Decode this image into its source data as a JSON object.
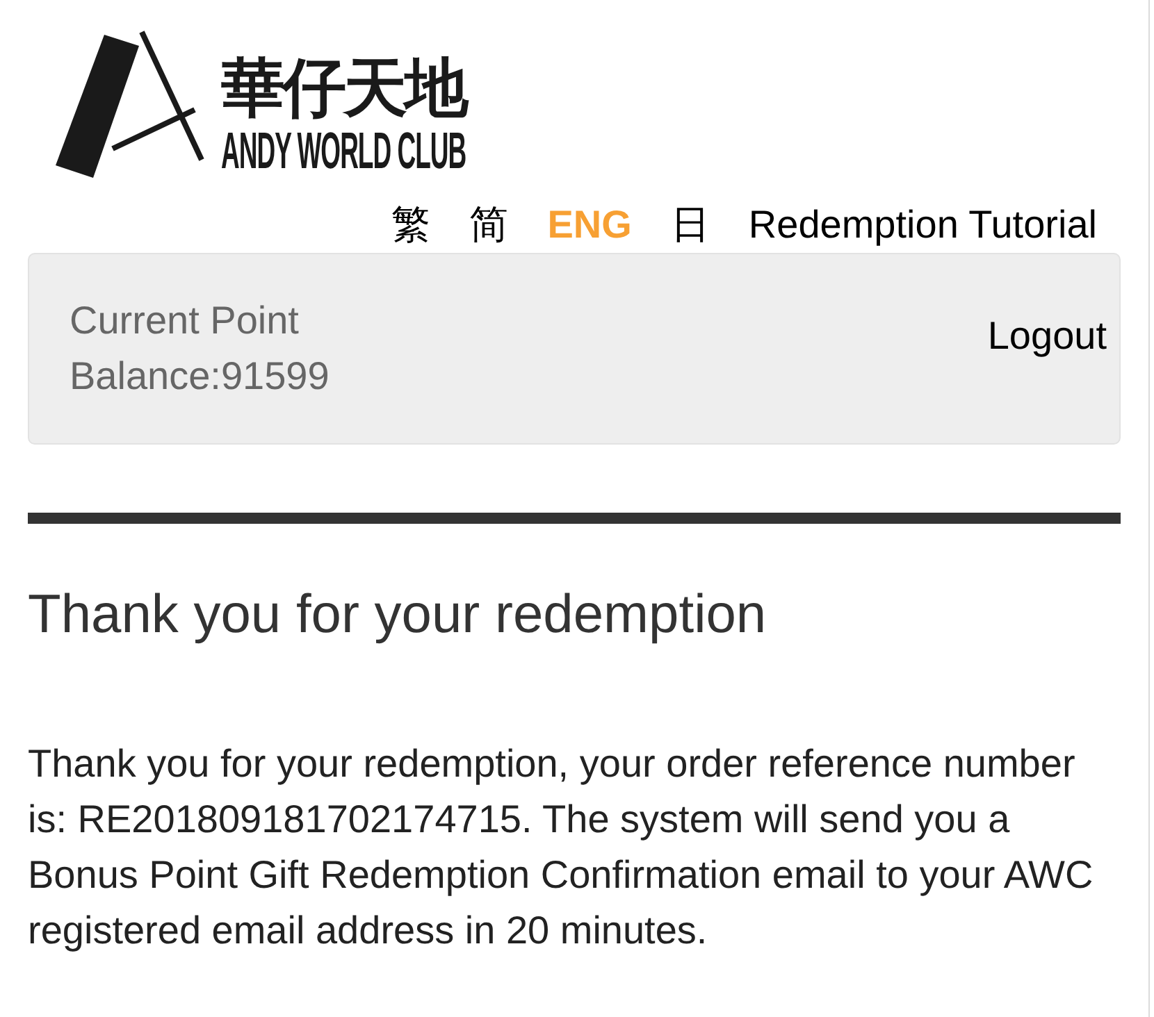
{
  "logo": {
    "name_zh": "華仔天地",
    "name_en": "ANDY WORLD CLUB"
  },
  "languages": [
    {
      "label": "繁",
      "selected": false
    },
    {
      "label": "简",
      "selected": false
    },
    {
      "label": "ENG",
      "selected": true
    },
    {
      "label": "日",
      "selected": false
    }
  ],
  "tutorial_link": "Redemption Tutorial",
  "account_panel": {
    "balance": "Current Point Balance:91599",
    "logout": "Logout"
  },
  "title": "Thank you for your redemption",
  "message": "Thank you for your redemption, your order reference number is: RE201809181702174715. The system will send you a Bonus Point Gift Redemption Confirmation email to your AWC registered email address in 20 minutes."
}
